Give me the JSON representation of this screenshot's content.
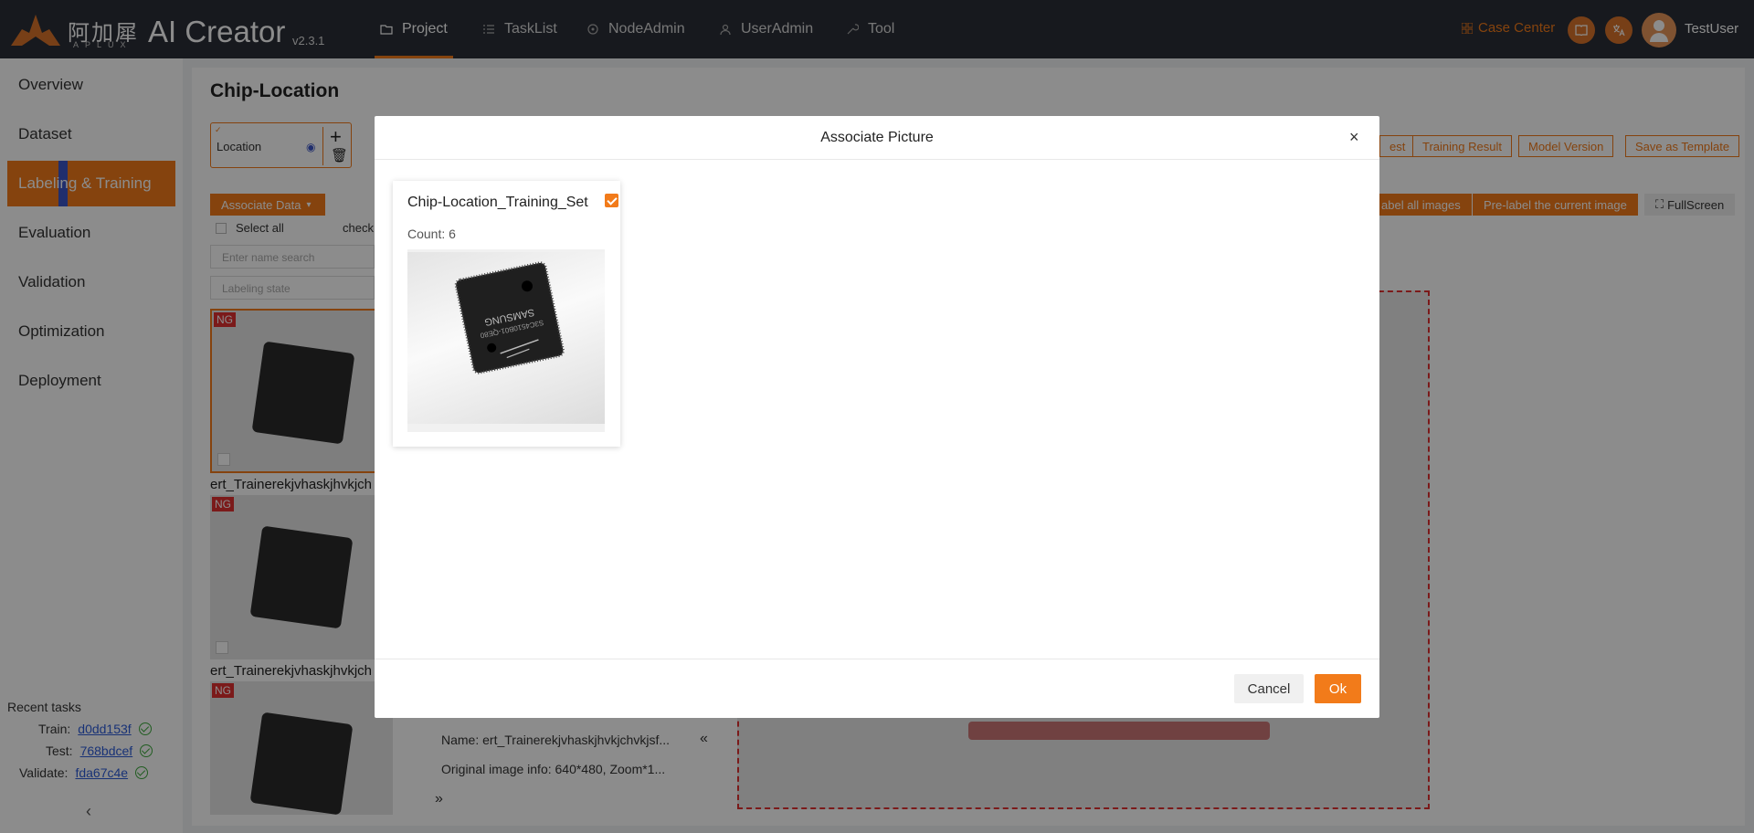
{
  "header": {
    "logo_cn": "阿加犀",
    "logo_sub": "APLUX",
    "app_name": "AI Creator",
    "version": "v2.3.1",
    "nav": [
      {
        "label": "Project",
        "icon": "folder-icon",
        "active": true
      },
      {
        "label": "TaskList",
        "icon": "list-icon",
        "active": false
      },
      {
        "label": "NodeAdmin",
        "icon": "node-icon",
        "active": false
      },
      {
        "label": "UserAdmin",
        "icon": "users-icon",
        "active": false
      },
      {
        "label": "Tool",
        "icon": "wrench-icon",
        "active": false
      }
    ],
    "case_center": "Case Center",
    "username": "TestUser"
  },
  "sidebar": {
    "items": [
      {
        "label": "Overview"
      },
      {
        "label": "Dataset"
      },
      {
        "label": "Labeling & Training"
      },
      {
        "label": "Evaluation"
      },
      {
        "label": "Validation"
      },
      {
        "label": "Optimization"
      },
      {
        "label": "Deployment"
      }
    ],
    "recent_title": "Recent tasks",
    "recent": [
      {
        "label": "Train:",
        "id": "d0dd153f"
      },
      {
        "label": "Test:",
        "id": "768bdcef"
      },
      {
        "label": "Validate:",
        "id": "fda67c4e"
      }
    ],
    "collapse": "‹"
  },
  "page": {
    "title": "Chip-Location",
    "label_name": "Location",
    "toolbar": {
      "btn_est": "est",
      "training_result": "Training Result",
      "model_version": "Model Version",
      "save_template": "Save as Template",
      "label_all": "abel all images",
      "pre_label_current": "Pre-label the current image",
      "fullscreen": "FullScreen"
    },
    "associate_data": "Associate Data",
    "select_all": "Select all",
    "check_text": "check",
    "search_placeholder": "Enter name search",
    "state_placeholder": "Labeling state",
    "thumbs": [
      {
        "badge": "NG",
        "name": "ert_Trainerekjvhaskjhvkjch"
      },
      {
        "badge": "NG",
        "name": "ert_Trainerekjvhaskjhvkjch"
      },
      {
        "badge": "NG",
        "name": ""
      }
    ],
    "info_name": "Name:  ert_Trainerekjvhaskjhvkjchvkjsf...",
    "info_orig": "Original image info:  640*480,  Zoom*1...",
    "collapse_left": "«",
    "expand_right": "»"
  },
  "modal": {
    "title": "Associate Picture",
    "close": "×",
    "dataset": {
      "name": "Chip-Location_Training_Set",
      "count": "Count: 6",
      "checked": true
    },
    "cancel": "Cancel",
    "ok": "Ok"
  },
  "colors": {
    "accent": "#f27b1a",
    "nav_bg": "#2b2f38",
    "ng_badge": "#e03030",
    "link": "#2d5bd8",
    "success": "#3daa3d"
  }
}
